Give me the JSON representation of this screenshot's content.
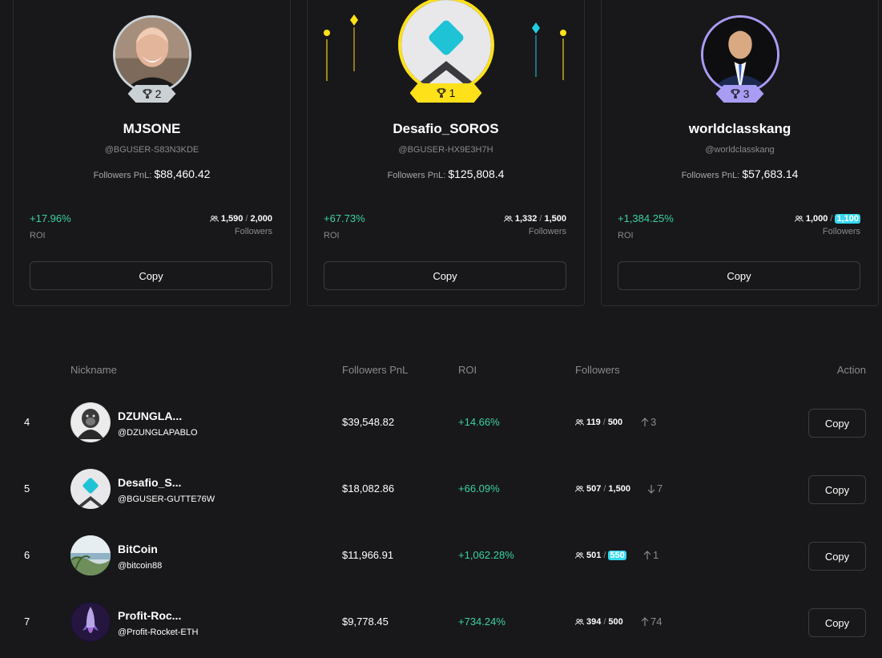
{
  "colors": {
    "background": "#18181a",
    "positive": "#3ad29f",
    "gold": "#ffe11a",
    "silver": "#c9d1d4",
    "bronze": "#a99cf5",
    "highlight": "#34d9f0"
  },
  "podium": [
    {
      "rank": "2",
      "name": "MJSONE",
      "handle": "@BGUSER-S83N3KDE",
      "pnl_label": "Followers PnL:",
      "pnl": "$88,460.42",
      "roi": "+17.96%",
      "roi_label": "ROI",
      "followers_current": "1,590",
      "followers_max": "2,000",
      "followers_label": "Followers",
      "copy_label": "Copy",
      "avatar": "bald-man-photo"
    },
    {
      "rank": "1",
      "name": "Desafio_SOROS",
      "handle": "@BGUSER-HX9E3H7H",
      "pnl_label": "Followers PnL:",
      "pnl": "$125,808.4",
      "roi": "+67.73%",
      "roi_label": "ROI",
      "followers_current": "1,332",
      "followers_max": "1,500",
      "followers_label": "Followers",
      "copy_label": "Copy",
      "avatar": "default-diamond-avatar"
    },
    {
      "rank": "3",
      "name": "worldclasskang",
      "handle": "@worldclasskang",
      "pnl_label": "Followers PnL:",
      "pnl": "$57,683.14",
      "roi": "+1,384.25%",
      "roi_label": "ROI",
      "followers_current": "1,000",
      "followers_max": "1,100",
      "followers_label": "Followers",
      "copy_label": "Copy",
      "avatar": "man-in-suit-photo"
    }
  ],
  "table": {
    "headers": {
      "nickname": "Nickname",
      "pnl": "Followers PnL",
      "roi": "ROI",
      "followers": "Followers",
      "action": "Action"
    },
    "rows": [
      {
        "rank": "4",
        "name": "DZUNGLA...",
        "handle": "@DZUNGLAPABLO",
        "pnl": "$39,548.82",
        "roi": "+14.66%",
        "followers_current": "119",
        "followers_max": "500",
        "trend_icon": "arrow-up-icon",
        "trend": "3",
        "copy_label": "Copy",
        "avatar": "gorilla-avatar"
      },
      {
        "rank": "5",
        "name": "Desafio_S...",
        "handle": "@BGUSER-GUTTE76W",
        "pnl": "$18,082.86",
        "roi": "+66.09%",
        "followers_current": "507",
        "followers_max": "1,500",
        "trend_icon": "arrow-down-icon",
        "trend": "7",
        "copy_label": "Copy",
        "avatar": "default-diamond-avatar"
      },
      {
        "rank": "6",
        "name": "BitCoin",
        "handle": "@bitcoin88",
        "pnl": "$11,966.91",
        "roi": "+1,062.28%",
        "followers_current": "501",
        "followers_max": "550",
        "trend_icon": "arrow-up-icon",
        "trend": "1",
        "copy_label": "Copy",
        "avatar": "beach-landscape-avatar"
      },
      {
        "rank": "7",
        "name": "Profit-Roc...",
        "handle": "@Profit-Rocket-ETH",
        "pnl": "$9,778.45",
        "roi": "+734.24%",
        "followers_current": "394",
        "followers_max": "500",
        "trend_icon": "arrow-up-icon",
        "trend": "74",
        "copy_label": "Copy",
        "avatar": "rocket-avatar"
      }
    ]
  }
}
